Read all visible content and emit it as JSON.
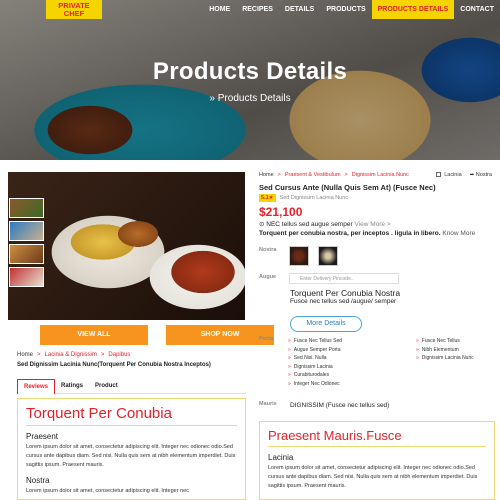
{
  "nav": {
    "logo_line1": "PRIVATE",
    "logo_line2": "CHEF",
    "links": [
      "HOME",
      "RECIPES",
      "DETAILS",
      "PRODUCTS",
      "PRODUCTS DETAILS",
      "CONTACT"
    ]
  },
  "hero": {
    "title": "Products Details",
    "breadcrumb": "» Products Details"
  },
  "left": {
    "buttons": {
      "view_all": "VIEW ALL",
      "shop_now": "SHOP NOW"
    },
    "breadcrumb": [
      "Home",
      "Lacinia & Dignissim",
      "Dapibus"
    ],
    "subtitle": "Sed Dignissim Lacinia Nunc(Torquent Per Conubia Nostra Inceptos)",
    "tabs": [
      "Reviews",
      "Ratings",
      "Product"
    ],
    "card": {
      "heading": "Torquent Per Conubia",
      "sub1": "Praesent",
      "text1": "Lorem ipsum dolor sit amet, consectetur adipiscing elit. Integer nec odionec odio.Sed cursus ante dapibus diam. Sed nisi. Nulla quis sem at nibh elementum imperdiet. Duis sagittis ipsum. Praesent mauris.",
      "sub2": "Nostra",
      "text2": "Lorem ipsum dolor sit amet, consectetur adipiscing elit. Integer nec"
    }
  },
  "right": {
    "breadcrumb": [
      "Home",
      "Praesent & Vestibulum",
      "Dignissim Lacinia Nunc"
    ],
    "meta": {
      "lacinia": "Lacinia",
      "nostra": "Nostra"
    },
    "title": "Sed Cursus Ante (Nulla Quis Sem At) (Fusce Nec)",
    "rating_badge": "5.1★",
    "rating_label": "Sed Dignissim Lacinia Nunc",
    "price": "$21,100",
    "info": "NEC tellus sed augue semper",
    "info_more": "View More >",
    "tagline": "Torquent per conubia nostra, per inceptos . ligula in libero.",
    "tagline_more": "Know More",
    "labels": {
      "nostra": "Nostra",
      "augue": "Augue",
      "porta": "Porta",
      "mauris": "Mauris"
    },
    "pincode_placeholder": "Enter Delivery Pincode..",
    "product_title": "Torquent Per Conubia Nostra",
    "product_desc": "Fusce nec tellus sed /augue/ semper",
    "more_details": "More Details",
    "features_col1": [
      "Fusce Nec Tellus Sed",
      "Augue Semper Porta",
      "Sed Nisi. Nulla",
      "Dignissim Lacinia",
      "Curabiturodales",
      "Integer Nec Odionec"
    ],
    "features_col2": [
      "Fusce Nec Tellus",
      "Nibh Elementum",
      "Dignissim Lacinia Nunc"
    ],
    "mauris_text": "DIGNISSIM (Fusce nec tellus sed)",
    "card": {
      "heading": "Praesent Mauris.Fusce",
      "sub": "Lacinia",
      "text": "Lorem ipsum dolor sit amet, consectetur adipiscing elit. Integer nec odionec odio.Sed cursus ante dapibus diam. Sed nisi. Nulla quis sem at nibh elementum imperdiet. Duis sagittis ipsum. Praesent mauris."
    }
  }
}
